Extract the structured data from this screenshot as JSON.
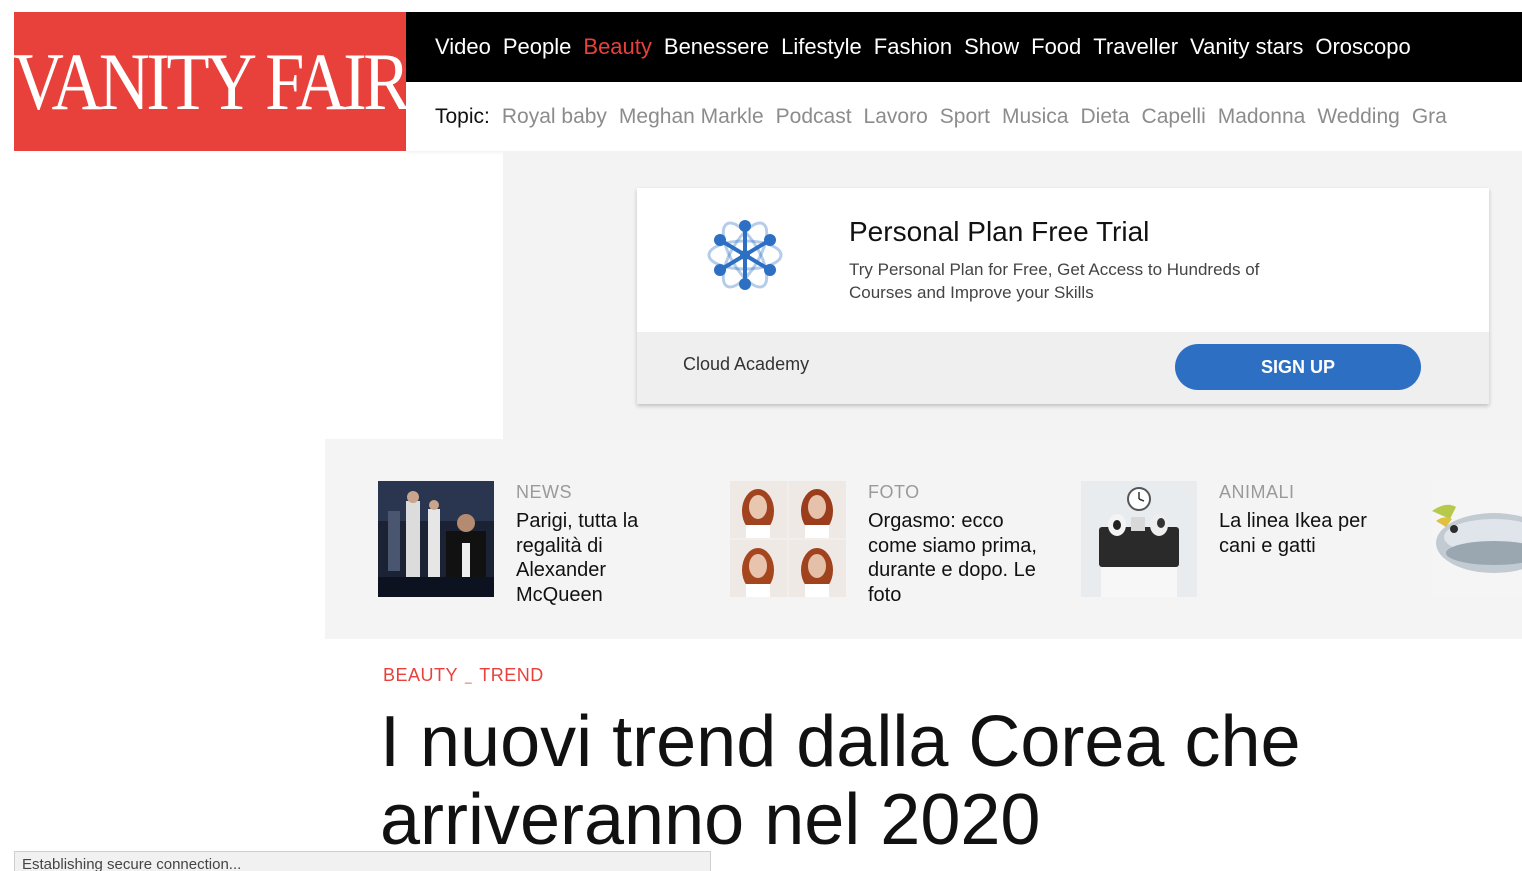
{
  "logo": {
    "text": "VANITY FAIR",
    "color": "#e8413c"
  },
  "nav": {
    "items": [
      {
        "label": "Video",
        "active": false
      },
      {
        "label": "People",
        "active": false
      },
      {
        "label": "Beauty",
        "active": true
      },
      {
        "label": "Benessere",
        "active": false
      },
      {
        "label": "Lifestyle",
        "active": false
      },
      {
        "label": "Fashion",
        "active": false
      },
      {
        "label": "Show",
        "active": false
      },
      {
        "label": "Food",
        "active": false
      },
      {
        "label": "Traveller",
        "active": false
      },
      {
        "label": "Vanity stars",
        "active": false
      },
      {
        "label": "Oroscopo",
        "active": false
      }
    ]
  },
  "topics": {
    "label": "Topic:",
    "items": [
      "Royal baby",
      "Meghan Markle",
      "Podcast",
      "Lavoro",
      "Sport",
      "Musica",
      "Dieta",
      "Capelli",
      "Madonna",
      "Wedding",
      "Gra"
    ]
  },
  "ad": {
    "title": "Personal Plan Free Trial",
    "description": "Try Personal Plan for Free, Get Access to Hundreds of Courses and Improve your Skills",
    "brand": "Cloud Academy",
    "cta": "SIGN UP",
    "cta_color": "#2d6fc2",
    "icon": "cloud-academy-logo-icon"
  },
  "related": [
    {
      "category": "NEWS",
      "title": "Parigi, tutta la regalità di Alexander McQueen",
      "image": "runway-photo"
    },
    {
      "category": "FOTO",
      "title": "Orgasmo: ecco come siamo prima, durante e dopo. Le foto",
      "image": "woman-portrait-grid"
    },
    {
      "category": "ANIMALI",
      "title": "La linea Ikea per cani e gatti",
      "image": "pet-bed-photo"
    },
    {
      "category": "",
      "title": "",
      "image": "fish-photo"
    }
  ],
  "article": {
    "tags": [
      "BEAUTY",
      "TREND"
    ],
    "headline": "I nuovi trend dalla Corea che arriveranno nel 2020"
  },
  "status": {
    "text": "Establishing secure connection..."
  }
}
